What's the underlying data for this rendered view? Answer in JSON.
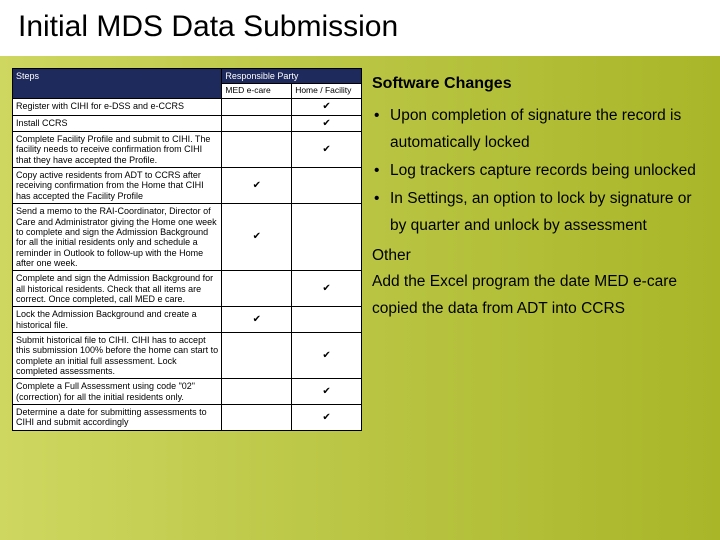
{
  "title": "Initial MDS Data Submission",
  "table": {
    "head_steps": "Steps",
    "head_party": "Responsible Party",
    "sub_med": "MED e-care",
    "sub_home": "Home / Facility",
    "rows": [
      {
        "step": "Register with CIHI for e-DSS and e-CCRS",
        "med": "",
        "home": "✔"
      },
      {
        "step": "Install CCRS",
        "med": "",
        "home": "✔"
      },
      {
        "step": "Complete Facility Profile and submit to CIHI. The facility needs to receive confirmation from CIHI that they have accepted the Profile.",
        "med": "",
        "home": "✔"
      },
      {
        "step": "Copy active residents from ADT to CCRS after receiving confirmation from the Home that CIHI has accepted the Facility Profile",
        "med": "✔",
        "home": ""
      },
      {
        "step": "Send a memo to the RAI-Coordinator, Director of Care and Administrator giving the Home one week to complete and sign the Admission Background for all the initial residents only and schedule a reminder in Outlook to follow-up with the Home after one week.",
        "med": "✔",
        "home": ""
      },
      {
        "step": "Complete and sign the Admission Background for all historical residents. Check that all items are correct. Once completed, call MED e care.",
        "med": "",
        "home": "✔"
      },
      {
        "step": "Lock the Admission Background and create a historical file.",
        "med": "✔",
        "home": ""
      },
      {
        "step": "Submit historical file to CIHI. CIHI has to accept this submission 100% before the home can start to complete an initial full assessment. Lock completed assessments.",
        "med": "",
        "home": "✔"
      },
      {
        "step": "Complete a Full Assessment using code \"02\" (correction) for all the initial residents only.",
        "med": "",
        "home": "✔"
      },
      {
        "step": "Determine a date for submitting assessments to CIHI and submit accordingly",
        "med": "",
        "home": "✔"
      }
    ]
  },
  "right": {
    "heading": "Software Changes",
    "bullets": [
      "Upon completion of signature the record is automatically locked",
      "Log trackers capture records being unlocked",
      "In Settings, an option to lock by signature or by quarter and unlock by assessment"
    ],
    "subhead": "Other",
    "tail": "Add the Excel program the date MED e-care copied the data from ADT into CCRS"
  }
}
